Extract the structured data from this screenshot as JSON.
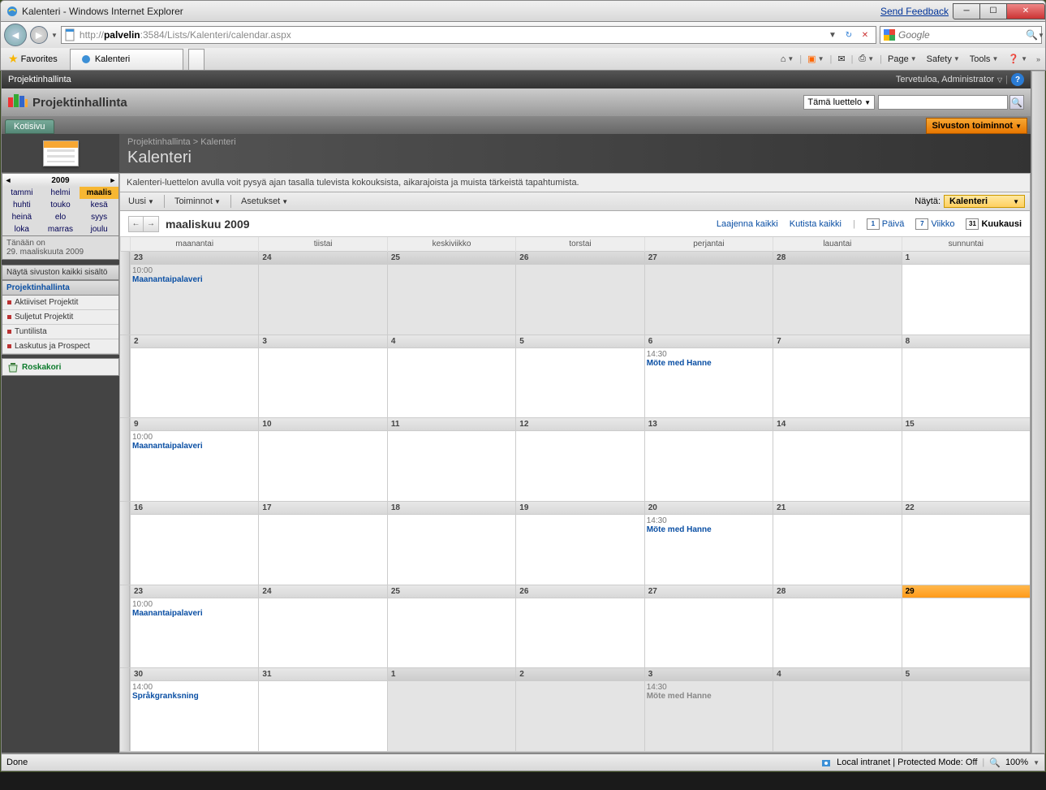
{
  "window": {
    "title": "Kalenteri - Windows Internet Explorer",
    "feedback": "Send Feedback"
  },
  "address": {
    "url": "http://palvelin:3584/Lists/Kalenteri/calendar.aspx",
    "url_host": "palvelin",
    "url_path": ":3584/Lists/Kalenteri/calendar.aspx",
    "search_engine": "Google"
  },
  "favbar": {
    "favorites": "Favorites",
    "tab": "Kalenteri"
  },
  "cmdbar": {
    "page": "Page",
    "safety": "Safety",
    "tools": "Tools"
  },
  "sp": {
    "site_link": "Projektinhallinta",
    "welcome": "Tervetuloa, Administrator",
    "site_title": "Projektinhallinta",
    "search_scope": "Tämä luettelo",
    "home_tab": "Kotisivu",
    "site_actions": "Sivuston toiminnot"
  },
  "breadcrumb": {
    "parent": "Projektinhallinta",
    "sep": ">",
    "current": "Kalenteri"
  },
  "page": {
    "title": "Kalenteri",
    "description": "Kalenteri-luettelon avulla voit pysyä ajan tasalla tulevista kokouksista, aikarajoista ja muista tärkeistä tapahtumista."
  },
  "toolbar": {
    "new": "Uusi",
    "actions": "Toiminnot",
    "settings": "Asetukset",
    "view_label": "Näytä:",
    "view_value": "Kalenteri"
  },
  "mini": {
    "year": "2009",
    "months": [
      "tammi",
      "helmi",
      "maalis",
      "huhti",
      "touko",
      "kesä",
      "heinä",
      "elo",
      "syys",
      "loka",
      "marras",
      "joulu"
    ],
    "selected": "maalis"
  },
  "today": {
    "label": "Tänään on",
    "value": "29. maaliskuuta 2009"
  },
  "leftnav": {
    "all_content": "Näytä sivuston kaikki sisältö",
    "header": "Projektinhallinta",
    "items": [
      "Aktiiviset Projektit",
      "Suljetut Projektit",
      "Tuntilista",
      "Laskutus ja Prospect"
    ],
    "recycle": "Roskakori"
  },
  "calhdr": {
    "month": "maaliskuu 2009",
    "expand": "Laajenna kaikki",
    "collapse": "Kutista kaikki",
    "day": "Päivä",
    "week": "Viikko",
    "month_btn": "Kuukausi"
  },
  "daynames": [
    "maanantai",
    "tiistai",
    "keskiviikko",
    "torstai",
    "perjantai",
    "lauantai",
    "sunnuntai"
  ],
  "weeks": [
    {
      "days": [
        {
          "n": "23",
          "other": true,
          "events": [
            {
              "time": "10:00",
              "title": "Maanantaipalaveri"
            }
          ]
        },
        {
          "n": "24",
          "other": true
        },
        {
          "n": "25",
          "other": true
        },
        {
          "n": "26",
          "other": true
        },
        {
          "n": "27",
          "other": true
        },
        {
          "n": "28",
          "other": true
        },
        {
          "n": "1"
        }
      ]
    },
    {
      "days": [
        {
          "n": "2"
        },
        {
          "n": "3"
        },
        {
          "n": "4"
        },
        {
          "n": "5"
        },
        {
          "n": "6",
          "events": [
            {
              "time": "14:30",
              "title": "Möte med Hanne"
            }
          ]
        },
        {
          "n": "7"
        },
        {
          "n": "8"
        }
      ]
    },
    {
      "days": [
        {
          "n": "9",
          "events": [
            {
              "time": "10:00",
              "title": "Maanantaipalaveri"
            }
          ]
        },
        {
          "n": "10"
        },
        {
          "n": "11"
        },
        {
          "n": "12"
        },
        {
          "n": "13"
        },
        {
          "n": "14"
        },
        {
          "n": "15"
        }
      ]
    },
    {
      "days": [
        {
          "n": "16"
        },
        {
          "n": "17"
        },
        {
          "n": "18"
        },
        {
          "n": "19"
        },
        {
          "n": "20",
          "events": [
            {
              "time": "14:30",
              "title": "Möte med Hanne"
            }
          ]
        },
        {
          "n": "21"
        },
        {
          "n": "22"
        }
      ]
    },
    {
      "days": [
        {
          "n": "23",
          "events": [
            {
              "time": "10:00",
              "title": "Maanantaipalaveri"
            }
          ]
        },
        {
          "n": "24"
        },
        {
          "n": "25"
        },
        {
          "n": "26"
        },
        {
          "n": "27"
        },
        {
          "n": "28"
        },
        {
          "n": "29",
          "today": true
        }
      ]
    },
    {
      "days": [
        {
          "n": "30",
          "events": [
            {
              "time": "14:00",
              "title": "Språkgranksning"
            }
          ]
        },
        {
          "n": "31"
        },
        {
          "n": "1",
          "other": true
        },
        {
          "n": "2",
          "other": true
        },
        {
          "n": "3",
          "other": true,
          "events": [
            {
              "time": "14:30",
              "title": "Möte med Hanne",
              "other": true
            }
          ]
        },
        {
          "n": "4",
          "other": true
        },
        {
          "n": "5",
          "other": true
        }
      ]
    }
  ],
  "statusbar": {
    "done": "Done",
    "zone": "Local intranet | Protected Mode: Off",
    "zoom": "100%"
  }
}
